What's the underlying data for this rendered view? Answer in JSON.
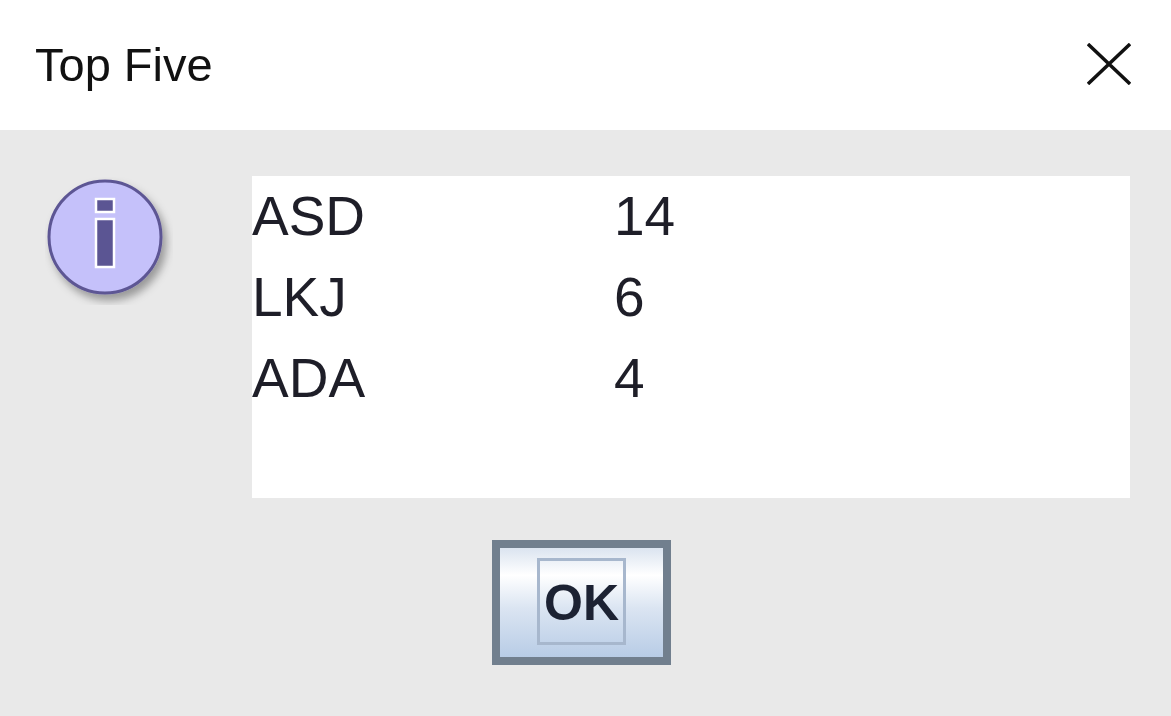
{
  "window": {
    "title": "Top Five"
  },
  "message": {
    "rows": [
      {
        "name": "ASD",
        "score": "14"
      },
      {
        "name": "LKJ",
        "score": "6"
      },
      {
        "name": "ADA",
        "score": "4"
      }
    ]
  },
  "buttons": [
    {
      "label": "OK",
      "focused": true
    }
  ]
}
